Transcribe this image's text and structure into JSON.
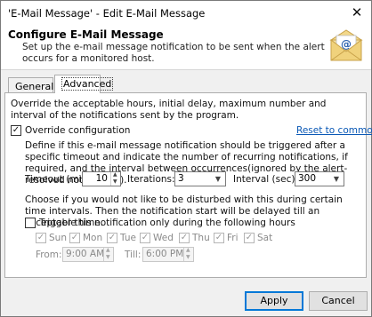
{
  "window": {
    "title": "'E-Mail Message' - Edit E-Mail Message",
    "close_glyph": "✕"
  },
  "header": {
    "title": "Configure E-Mail Message",
    "description": "Set up the e-mail message notification to be sent when the alert occurs for a monitored host.",
    "icon": "envelope-icon"
  },
  "tabs": [
    {
      "label": "General"
    },
    {
      "label": "Advanced"
    }
  ],
  "advanced": {
    "intro": "Override the acceptable hours, initial delay, maximum number and interval of the notifications sent by the program.",
    "override_label": "Override configuration",
    "override_checked": true,
    "reset_link": "Reset to common",
    "define_text": "Define if this e-mail message notification should be triggered after a specific timeout and indicate the number of recurring notifications, if required, and the interval between occurrences(ignored by the alert-resolved notification).",
    "timeout": {
      "label": "Timeout (min):",
      "value": "10"
    },
    "iterations": {
      "label": "Iterations:",
      "value": "3"
    },
    "interval": {
      "label": "Interval (sec):",
      "value": "300"
    },
    "choose_text": "Choose if you would not like to be disturbed with this during certain time intervals. Then the notification start will be delayed till an acceptable time.",
    "trigger_label": "Trigger this notification only during the following hours",
    "trigger_checked": false,
    "days": [
      {
        "label": "Sun",
        "checked": true
      },
      {
        "label": "Mon",
        "checked": true
      },
      {
        "label": "Tue",
        "checked": true
      },
      {
        "label": "Wed",
        "checked": true
      },
      {
        "label": "Thu",
        "checked": true
      },
      {
        "label": "Fri",
        "checked": true
      },
      {
        "label": "Sat",
        "checked": true
      }
    ],
    "from": {
      "label": "From:",
      "value": "9:00 AM"
    },
    "till": {
      "label": "Till:",
      "value": "6:00 PM"
    }
  },
  "buttons": {
    "apply": "Apply",
    "cancel": "Cancel"
  },
  "colors": {
    "link": "#0b59b6",
    "accent": "#0078d7"
  }
}
